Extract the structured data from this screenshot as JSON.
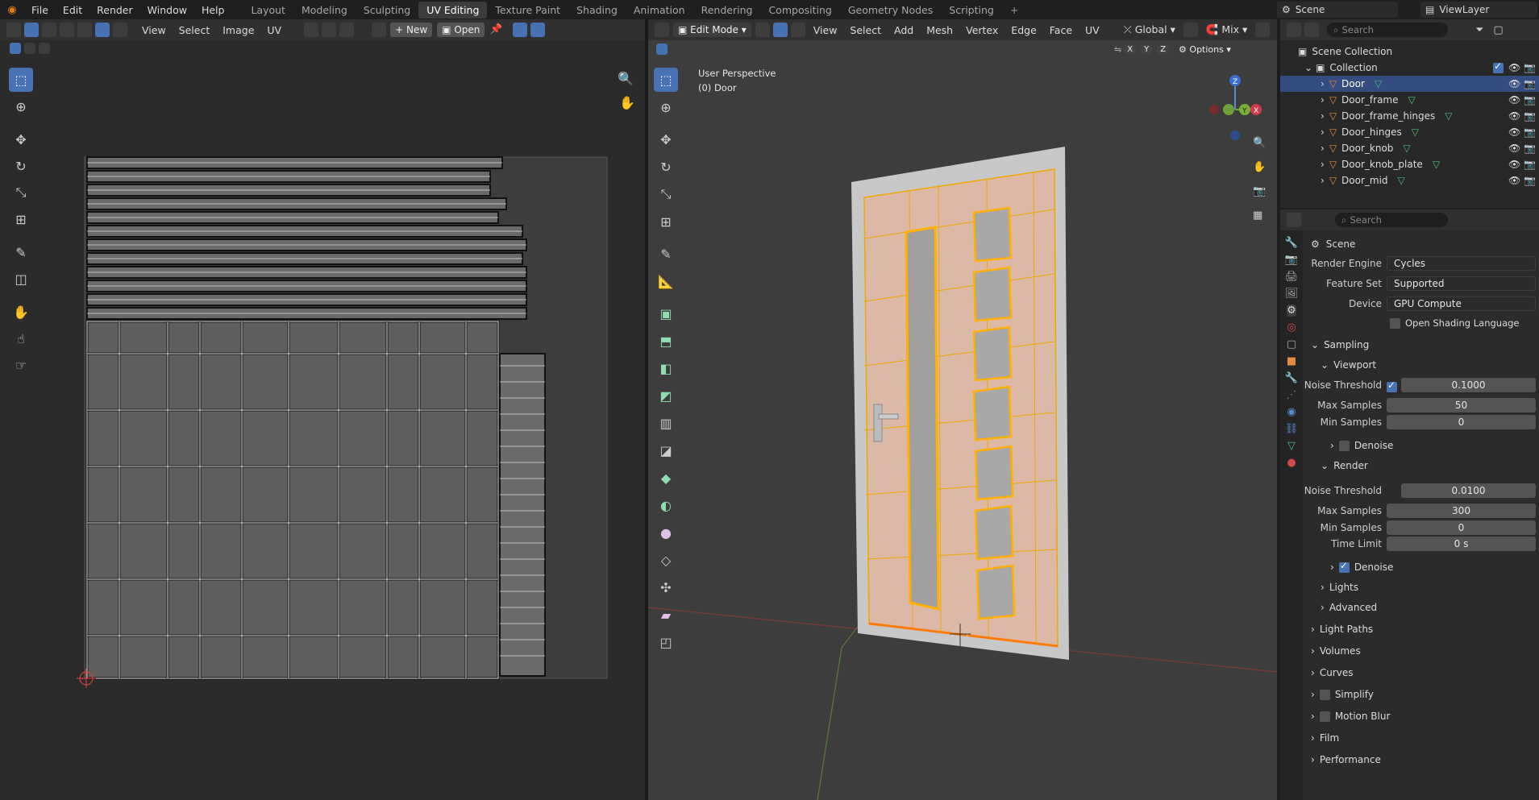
{
  "topbar": {
    "menus": [
      "File",
      "Edit",
      "Render",
      "Window",
      "Help"
    ],
    "workspaces": [
      "Layout",
      "Modeling",
      "Sculpting",
      "UV Editing",
      "Texture Paint",
      "Shading",
      "Animation",
      "Rendering",
      "Compositing",
      "Geometry Nodes",
      "Scripting"
    ],
    "active_workspace": "UV Editing",
    "scene_label": "Scene",
    "viewlayer_label": "ViewLayer"
  },
  "uv_editor": {
    "menus": [
      "View",
      "Select",
      "Image",
      "UV"
    ],
    "new_label": "New",
    "open_label": "Open"
  },
  "viewport": {
    "mode": "Edit Mode",
    "menus": [
      "View",
      "Select",
      "Add",
      "Mesh",
      "Vertex",
      "Edge",
      "Face",
      "UV"
    ],
    "transform": "Global",
    "snap": "Mix",
    "options_label": "Options",
    "perspective_label": "User Perspective",
    "object_label": "(0) Door",
    "axes": [
      "X",
      "Y",
      "Z"
    ]
  },
  "outliner": {
    "search_placeholder": "Search",
    "scene_collection": "Scene Collection",
    "collection": "Collection",
    "items": [
      "Door",
      "Door_frame",
      "Door_frame_hinges",
      "Door_hinges",
      "Door_knob",
      "Door_knob_plate",
      "Door_mid"
    ]
  },
  "properties": {
    "search_placeholder": "Search",
    "context": "Scene",
    "render_engine_label": "Render Engine",
    "render_engine": "Cycles",
    "feature_set_label": "Feature Set",
    "feature_set": "Supported",
    "device_label": "Device",
    "device": "GPU Compute",
    "osl_label": "Open Shading Language",
    "sampling": "Sampling",
    "viewport": "Viewport",
    "noise_threshold_label": "Noise Threshold",
    "vp_noise": "0.1000",
    "max_samples_label": "Max Samples",
    "vp_max": "50",
    "min_samples_label": "Min Samples",
    "vp_min": "0",
    "denoise_label": "Denoise",
    "render": "Render",
    "r_noise": "0.0100",
    "r_max": "300",
    "r_min": "0",
    "time_limit_label": "Time Limit",
    "r_time": "0 s",
    "sections": [
      "Lights",
      "Advanced",
      "Light Paths",
      "Volumes",
      "Curves",
      "Simplify",
      "Motion Blur",
      "Film",
      "Performance"
    ]
  },
  "colors": {
    "accent": "#4772b3",
    "selection": "#ffaf29",
    "panel": "#303030",
    "viewport_bg": "#3d3d3d"
  }
}
